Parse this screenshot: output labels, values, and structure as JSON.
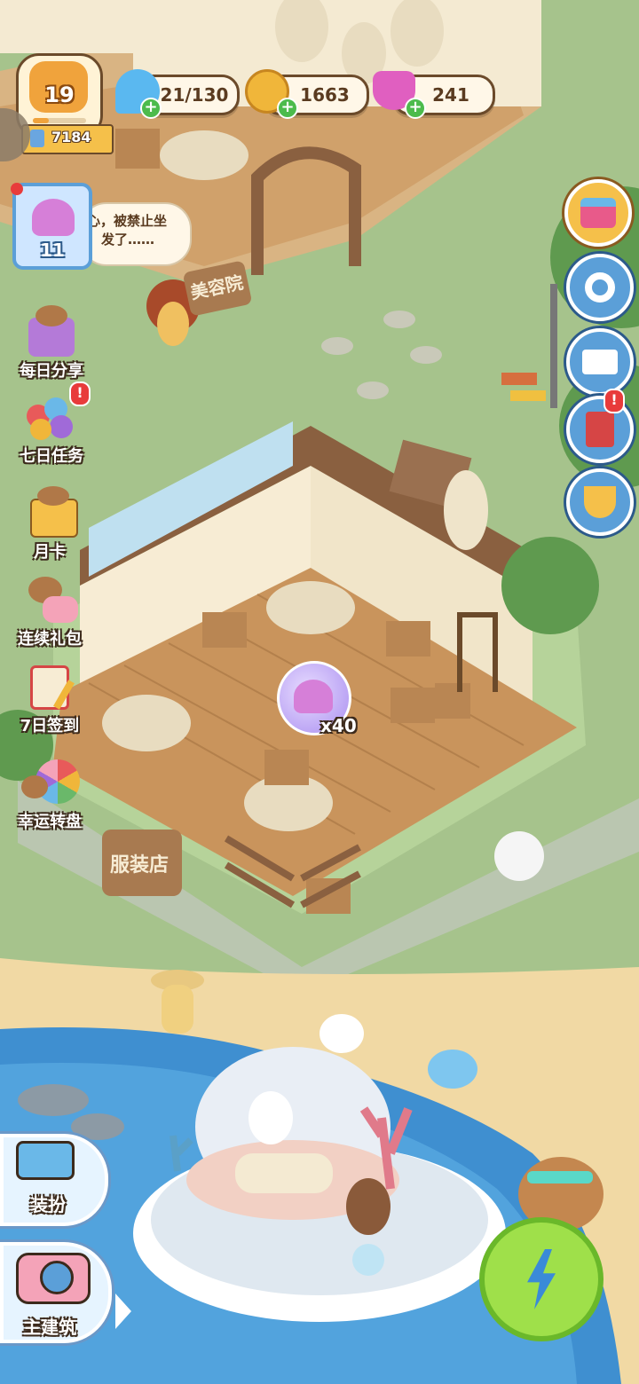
{
  "player": {
    "level": "19",
    "xp": "7184"
  },
  "resources": {
    "energy": "21/130",
    "coins": "1663",
    "gems": "241"
  },
  "shell_item": {
    "count": "11"
  },
  "speech_bubble": {
    "text_line1": "心，被禁止坐",
    "text_line2": "发了……"
  },
  "building_sign_top": "美容院",
  "building_sign_bottom": "服装店",
  "reward_bubble": {
    "count": "x40"
  },
  "left_menu": [
    {
      "label": "每日分享"
    },
    {
      "label": "七日任务"
    },
    {
      "label": "月卡"
    },
    {
      "label": "连续礼包"
    },
    {
      "label": "7日签到"
    },
    {
      "label": "幸运转盘"
    }
  ],
  "bottom_left": [
    {
      "label": "装扮"
    },
    {
      "label": "主建筑"
    }
  ],
  "colors": {
    "grass": "#9fbf86",
    "floor": "#c9945c",
    "water": "#3f8fd0",
    "sand": "#f1d9a4",
    "accent_blue": "#5b9fd8"
  }
}
